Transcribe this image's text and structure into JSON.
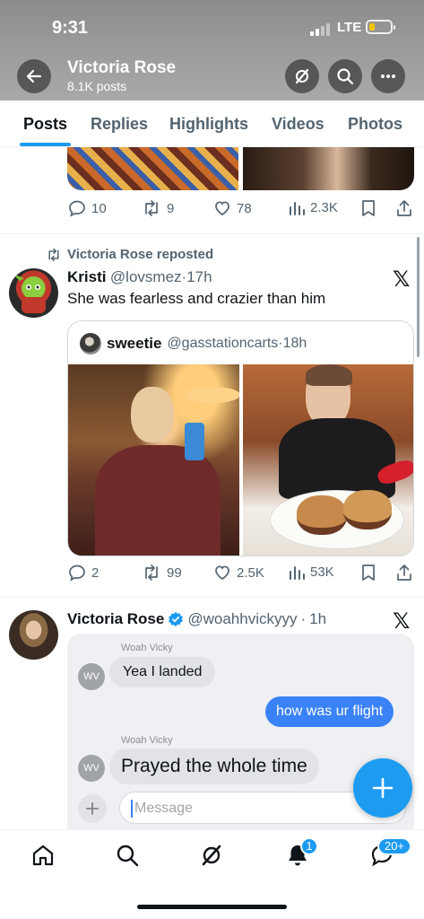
{
  "status": {
    "time": "9:31",
    "network": "LTE"
  },
  "header": {
    "title": "Victoria Rose",
    "subtitle": "8.1K posts"
  },
  "tabs": [
    {
      "label": "Posts"
    },
    {
      "label": "Replies"
    },
    {
      "label": "Highlights"
    },
    {
      "label": "Videos"
    },
    {
      "label": "Photos"
    }
  ],
  "post1_stats": {
    "replies": "10",
    "reposts": "9",
    "likes": "78",
    "views": "2.3K"
  },
  "post2": {
    "repost_label": "Victoria Rose reposted",
    "name": "Kristi",
    "handle": "@lovsmez",
    "time": "17h",
    "text": "She was fearless and crazier than him",
    "quote": {
      "name": "sweetie",
      "handle": "@gasstationcarts",
      "time": "18h"
    },
    "stats": {
      "replies": "2",
      "reposts": "99",
      "likes": "2.5K",
      "views": "53K"
    }
  },
  "post3": {
    "name": "Victoria Rose",
    "handle": "@woahhvickyyy",
    "time": "1h",
    "chat": {
      "sender_label_1": "Woah Vicky",
      "msg1": "Yea I landed",
      "msg2": "how was ur flight",
      "sender_label_2": "Woah Vicky",
      "msg3": "Prayed the whole time",
      "avatar_initials": "WV",
      "input_placeholder": "Message"
    }
  },
  "nav": {
    "notifications_badge": "1",
    "messages_badge": "20+"
  },
  "colors": {
    "accent": "#1d9bf0",
    "chat_blue": "#3a82f7",
    "header_bg": "#9a9a9c"
  }
}
